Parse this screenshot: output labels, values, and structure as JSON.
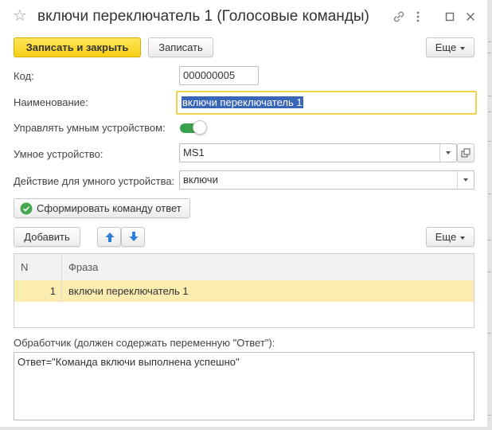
{
  "window": {
    "title": "включи переключатель 1 (Голосовые команды)",
    "icons": [
      "star-icon",
      "link-icon",
      "more-vertical-icon",
      "maximize-icon",
      "close-icon"
    ]
  },
  "toolbar": {
    "save_close_label": "Записать и закрыть",
    "save_label": "Записать",
    "more_label": "Еще"
  },
  "form": {
    "code_label": "Код:",
    "code_value": "000000005",
    "name_label": "Наименование:",
    "name_value": "включи переключатель 1",
    "manage_label": "Управлять умным устройством:",
    "manage_value": "on",
    "device_label": "Умное устройство:",
    "device_value": "MS1",
    "action_label": "Действие для умного устройства:",
    "action_value": "включи",
    "generate_label": "Сформировать команду ответ"
  },
  "table_toolbar": {
    "add_label": "Добавить",
    "more_label": "Еще"
  },
  "table": {
    "headers": [
      "N",
      "Фраза"
    ],
    "rows": [
      {
        "n": "1",
        "phrase": "включи переключатель 1"
      }
    ]
  },
  "handler": {
    "label": "Обработчик (должен содержать переменную \"Ответ\"):",
    "code": "Ответ=\"Команда включи выполнена успешно\""
  },
  "colors": {
    "accent_yellow": "#f6cf14",
    "selection_row": "#fbecb0",
    "toggle_on": "#3aa14a",
    "focus_border": "#f0d34a"
  }
}
